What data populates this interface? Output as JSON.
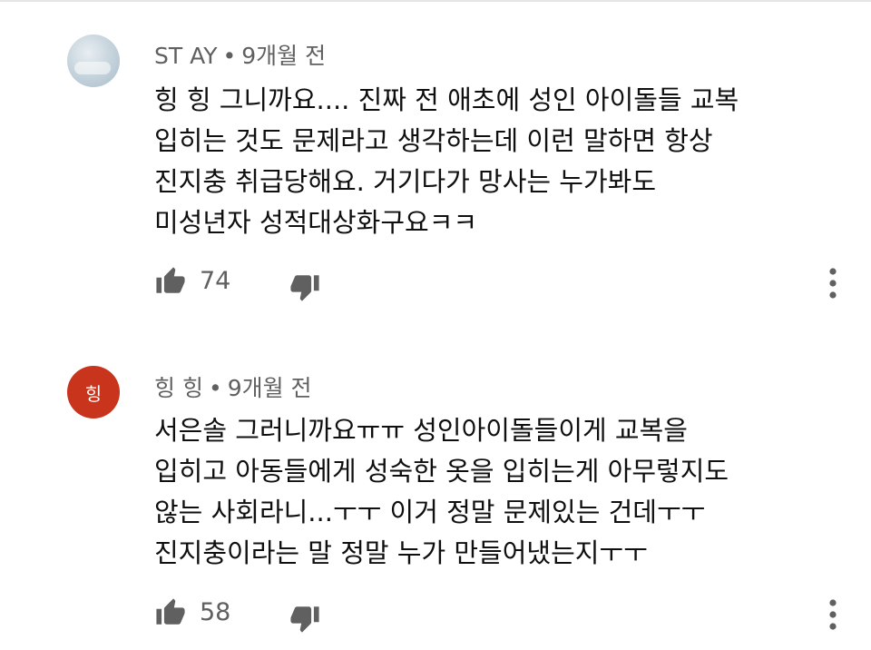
{
  "comments": [
    {
      "author": "ST AY",
      "separator": "•",
      "time": "9개월 전",
      "avatar_type": "photo",
      "lines": [
        "힝 힝 그니까요.... 진짜 전 애초에 성인 아이돌들 교복",
        "입히는 것도 문제라고 생각하는데 이런 말하면 항상",
        "진지충 취급당해요. 거기다가 망사는 누가봐도",
        "미성년자 성적대상화구요ㅋㅋ"
      ],
      "likes": "74"
    },
    {
      "author": "힝 힝",
      "separator": "•",
      "time": "9개월 전",
      "avatar_type": "letter",
      "avatar_letter": "힝",
      "avatar_color": "#c9341c",
      "lines": [
        "서은솔 그러니까요ㅠㅠ 성인아이돌들이게 교복을",
        "입히고 아동들에게 성숙한 옷을 입히는게 아무렇지도",
        "않는 사회라니...ㅜㅜ 이거 정말 문제있는 건데ㅜㅜ",
        "진지충이라는 말 정말 누가 만들어냈는지ㅜㅜ"
      ],
      "likes": "58"
    }
  ],
  "icons": {
    "like": "thumb-up-icon",
    "dislike": "thumb-down-icon",
    "more": "more-vert-icon"
  },
  "colors": {
    "text_primary": "#0f0f0f",
    "text_secondary": "#606060",
    "icon": "#606060"
  }
}
